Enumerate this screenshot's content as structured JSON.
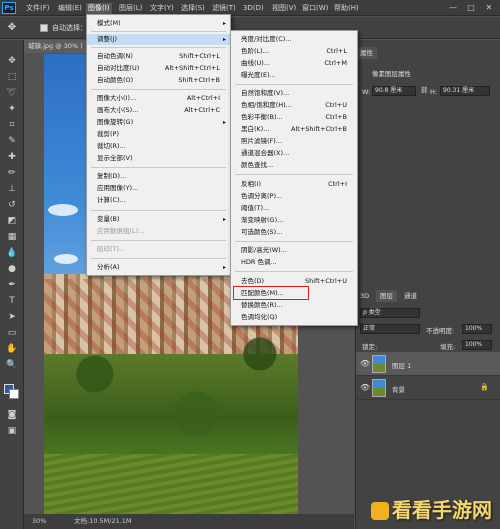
{
  "menubar": {
    "logo": "Ps",
    "items": [
      "文件(F)",
      "编辑(E)",
      "图像(I)",
      "图层(L)",
      "文字(Y)",
      "选择(S)",
      "滤镜(T)",
      "3D(D)",
      "视图(V)",
      "窗口(W)",
      "帮助(H)"
    ],
    "window_controls": [
      "—",
      "□",
      "✕"
    ]
  },
  "options": {
    "auto_select_label": "自动选择："
  },
  "document": {
    "tab": "城镇.jpg @ 30% ("
  },
  "status": {
    "zoom": "30%",
    "doc_info": "文档:10.5M/21.1M"
  },
  "image_menu": {
    "items": [
      {
        "label": "模式(M)",
        "shortcut": "",
        "arrow": "▸"
      },
      {
        "label": "调整(J)",
        "shortcut": "",
        "arrow": "▸",
        "highlight": true
      },
      {
        "label": "自动色调(N)",
        "shortcut": "Shift+Ctrl+L"
      },
      {
        "label": "自动对比度(U)",
        "shortcut": "Alt+Shift+Ctrl+L"
      },
      {
        "label": "自动颜色(O)",
        "shortcut": "Shift+Ctrl+B"
      },
      {
        "label": "图像大小(I)...",
        "shortcut": "Alt+Ctrl+I"
      },
      {
        "label": "画布大小(S)...",
        "shortcut": "Alt+Ctrl+C"
      },
      {
        "label": "图像旋转(G)",
        "shortcut": "",
        "arrow": "▸"
      },
      {
        "label": "裁剪(P)",
        "shortcut": ""
      },
      {
        "label": "裁切(R)...",
        "shortcut": ""
      },
      {
        "label": "显示全部(V)",
        "shortcut": ""
      },
      {
        "label": "复制(D)...",
        "shortcut": ""
      },
      {
        "label": "应用图像(Y)...",
        "shortcut": ""
      },
      {
        "label": "计算(C)...",
        "shortcut": ""
      },
      {
        "label": "变量(B)",
        "shortcut": "",
        "arrow": "▸"
      },
      {
        "label": "应用数据组(L)...",
        "shortcut": "",
        "disabled": true
      },
      {
        "label": "陷印(T)...",
        "shortcut": "",
        "disabled": true
      },
      {
        "label": "分析(A)",
        "shortcut": "",
        "arrow": "▸"
      }
    ]
  },
  "adjust_menu": {
    "items": [
      {
        "label": "亮度/对比度(C)...",
        "shortcut": ""
      },
      {
        "label": "色阶(L)...",
        "shortcut": "Ctrl+L"
      },
      {
        "label": "曲线(U)...",
        "shortcut": "Ctrl+M"
      },
      {
        "label": "曝光度(E)...",
        "shortcut": ""
      },
      {
        "label": "自然饱和度(V)...",
        "shortcut": ""
      },
      {
        "label": "色相/饱和度(H)...",
        "shortcut": "Ctrl+U"
      },
      {
        "label": "色彩平衡(B)...",
        "shortcut": "Ctrl+B"
      },
      {
        "label": "黑白(K)...",
        "shortcut": "Alt+Shift+Ctrl+B"
      },
      {
        "label": "照片滤镜(F)...",
        "shortcut": ""
      },
      {
        "label": "通道混合器(X)...",
        "shortcut": ""
      },
      {
        "label": "颜色查找...",
        "shortcut": ""
      },
      {
        "label": "反相(I)",
        "shortcut": "Ctrl+I"
      },
      {
        "label": "色调分离(P)...",
        "shortcut": ""
      },
      {
        "label": "阈值(T)...",
        "shortcut": ""
      },
      {
        "label": "渐变映射(G)...",
        "shortcut": ""
      },
      {
        "label": "可选颜色(S)...",
        "shortcut": ""
      },
      {
        "label": "阴影/高光(W)...",
        "shortcut": ""
      },
      {
        "label": "HDR 色调...",
        "shortcut": ""
      },
      {
        "label": "去色(D)",
        "shortcut": "Shift+Ctrl+U"
      },
      {
        "label": "匹配颜色(M)...",
        "shortcut": "",
        "boxed": true
      },
      {
        "label": "替换颜色(R)...",
        "shortcut": ""
      },
      {
        "label": "色调均化(Q)",
        "shortcut": ""
      }
    ]
  },
  "properties_panel": {
    "tab": "属性",
    "title": "像素图层属性",
    "w_label": "W:",
    "w_value": "90.8 厘米",
    "h_label": "H:",
    "h_value": "90.31 厘米",
    "link_icon": "link-icon"
  },
  "layers_panel": {
    "tabs": [
      "3D",
      "图层",
      "通道"
    ],
    "kind_label": "ρ 类型",
    "blend_mode": "正常",
    "opacity_label": "不透明度:",
    "opacity_value": "100%",
    "lock_label": "锁定:",
    "fill_label": "填充:",
    "fill_value": "100%",
    "layers": [
      {
        "name": "图层 1",
        "selected": true
      },
      {
        "name": "背景",
        "selected": false,
        "locked": true
      }
    ]
  },
  "watermark": {
    "text": "看看手游网"
  },
  "colors": {
    "menu_bg": "#f0f0f0",
    "highlight": "#c5dcf5",
    "redbox": "#e02020",
    "ui_dark": "#424242"
  }
}
